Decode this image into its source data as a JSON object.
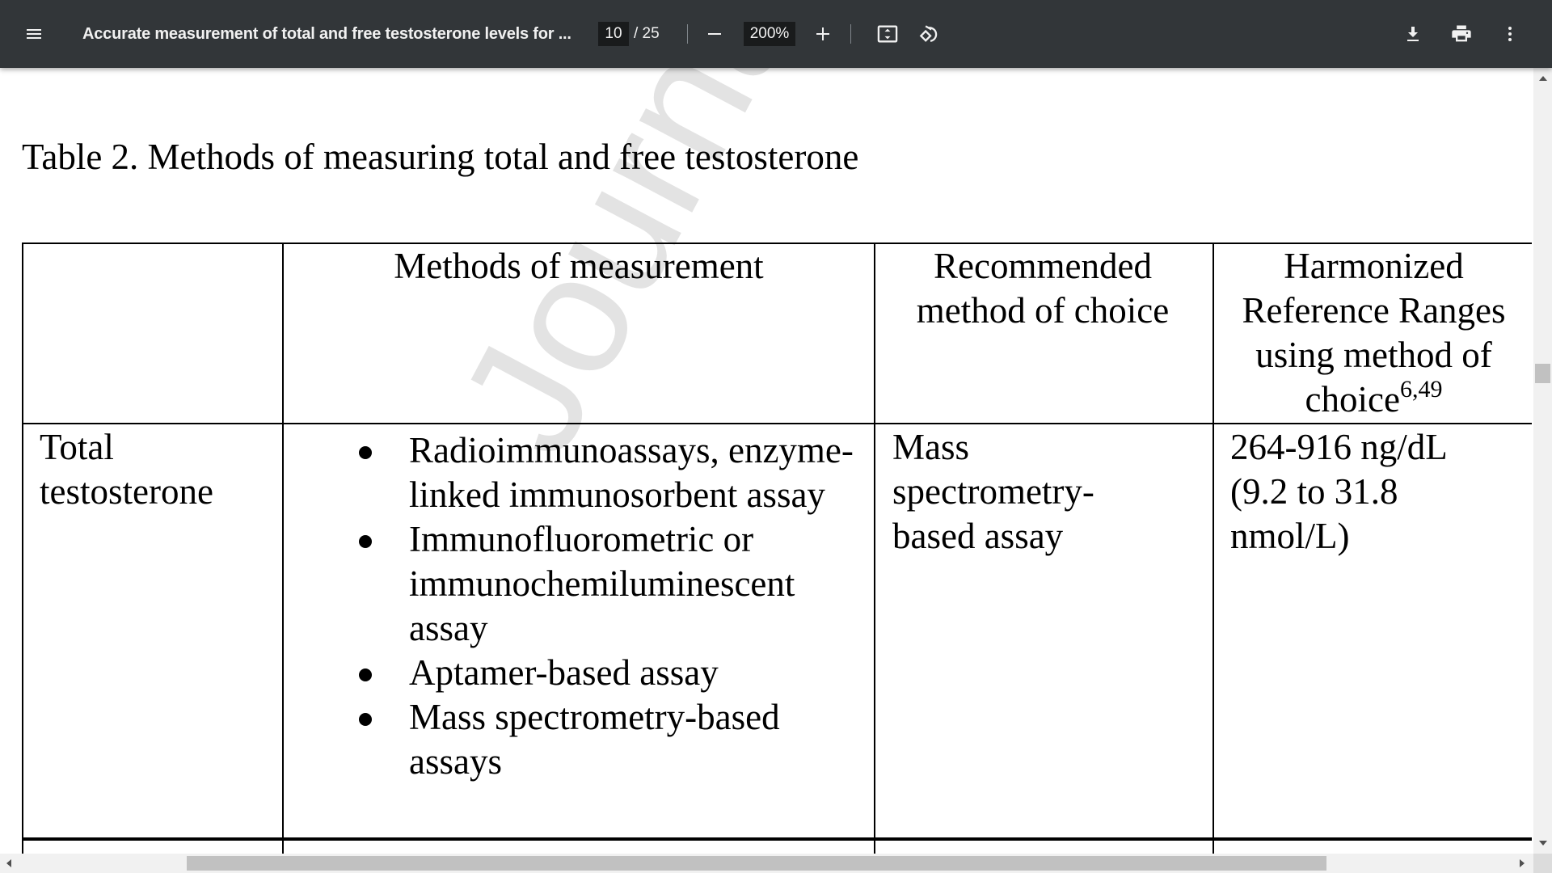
{
  "toolbar": {
    "document_title": "Accurate measurement of total and free testosterone levels for ...",
    "current_page": "10",
    "total_pages": "/ 25",
    "zoom_level": "200%",
    "background_color": "#323639",
    "icons": [
      "menu-icon",
      "zoom-out-icon",
      "zoom-in-icon",
      "fit-page-icon",
      "rotate-icon",
      "download-icon",
      "print-icon",
      "more-options-icon"
    ]
  },
  "document": {
    "watermark": "Journal",
    "table_title": "Table 2. Methods of measuring total and free testosterone",
    "headers": {
      "col2": "Methods of measurement",
      "col3": "Recommended method of choice",
      "col4_text": "Harmonized Reference Ranges using method of choice",
      "col4_sup": "6,49"
    },
    "rows": [
      {
        "label": "Total testosterone",
        "methods": [
          "Radioimmunoassays, enzyme-linked immunosorbent assay",
          "Immunofluorometric or immunochemiluminescent assay",
          "Aptamer-based assay",
          "Mass spectrometry-based assays"
        ],
        "recommended": "Mass spectrometry-based assay",
        "reference_range": "264-916 ng/dL (9.2 to 31.8 nmol/L)"
      }
    ]
  }
}
